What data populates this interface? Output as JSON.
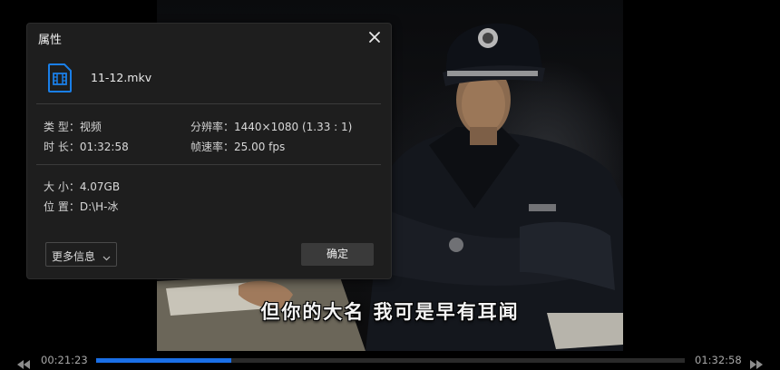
{
  "video": {
    "subtitle": "但你的大名  我可是早有耳闻"
  },
  "dialog": {
    "title": "属性",
    "close_icon": "close-icon",
    "file_icon": "video-file-icon",
    "file_name": "11-12.mkv",
    "type_label": "类 型：",
    "type_value": "视频",
    "duration_label": "时 长：",
    "duration_value": "01:32:58",
    "resolution_label": "分辨率：",
    "resolution_value": "1440×1080 (1.33 : 1)",
    "fps_label": "帧速率：",
    "fps_value": "25.00 fps",
    "size_label": "大 小：",
    "size_value": "4.07GB",
    "location_label": "位 置：",
    "location_value": "D:\\H-冰",
    "more_info_label": "更多信息",
    "ok_label": "确定",
    "accent": "#1a7fe8"
  },
  "playback": {
    "current_time": "00:21:23",
    "total_time": "01:32:58",
    "progress_fraction": 0.23,
    "progress_color": "#1a6fe6",
    "rewind_icon": "rewind-icon",
    "forward_icon": "fast-forward-icon"
  }
}
